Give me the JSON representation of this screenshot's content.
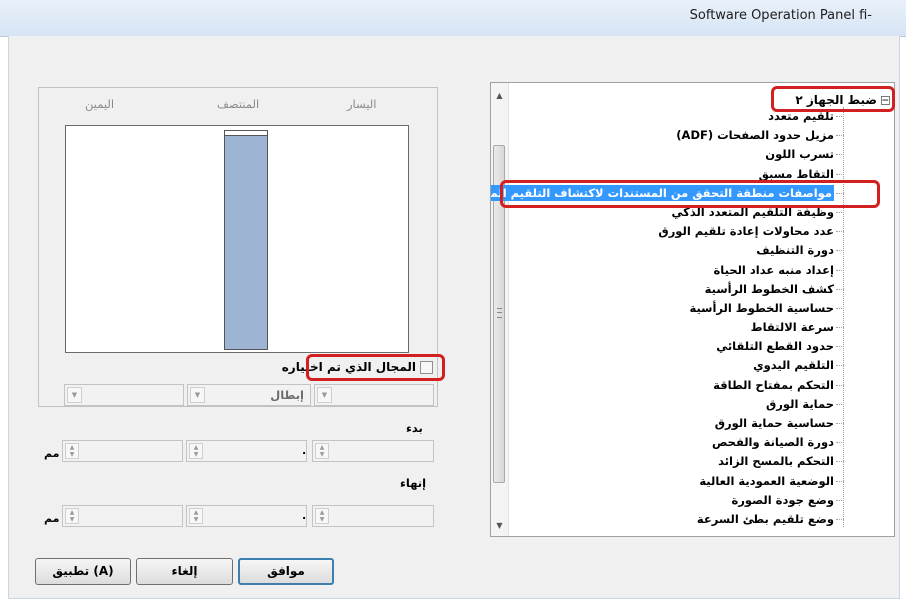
{
  "window": {
    "title": "Software Operation Panel fi-"
  },
  "tree": {
    "root_label": "ضبط الجهاز ٢",
    "items": [
      "تلقيم متعدد",
      "مزيل حدود الصفحات (ADF)",
      "تسرب اللون",
      "التقاط مسبق",
      "مواصفات منطقة التحقق من المستندات لاكتشاف التلقيم المتعدد",
      "وظيفة التلقيم المتعدد الذكي",
      "عدد محاولات إعادة تلقيم الورق",
      "دورة التنظيف",
      "إعداد منبه عداد الحياة",
      "كشف الخطوط الرأسية",
      "حساسية الخطوط الرأسية",
      "سرعة الالتقاط",
      "حدود القطع التلقائي",
      "التلقيم اليدوي",
      "التحكم بمفتاح الطاقة",
      "حماية الورق",
      "حساسية حماية الورق",
      "دورة الصيانة والفحص",
      "التحكم بالمسح الزائد",
      "الوضعية العمودية العالية",
      "وضع جودة الصورة",
      "وضع تلقيم بطئ السرعة"
    ],
    "selected_index": 4
  },
  "preview": {
    "col_left": "اليسار",
    "col_center": "المنتصف",
    "col_right": "اليمين",
    "checkbox_label": "المجال الذي تم اختياره",
    "checkbox_checked": false
  },
  "settings": {
    "combo_right_value": "إبطال",
    "start_label": "بدء",
    "end_label": "إنهاء",
    "unit": "مم",
    "decimal_point": "."
  },
  "buttons": {
    "ok": "موافق",
    "cancel": "إلغاء",
    "apply": "تطبيق (A)"
  },
  "colors": {
    "highlight_box": "#d21f1f",
    "selection": "#3399ff",
    "paper_fill": "#9db4d3"
  }
}
